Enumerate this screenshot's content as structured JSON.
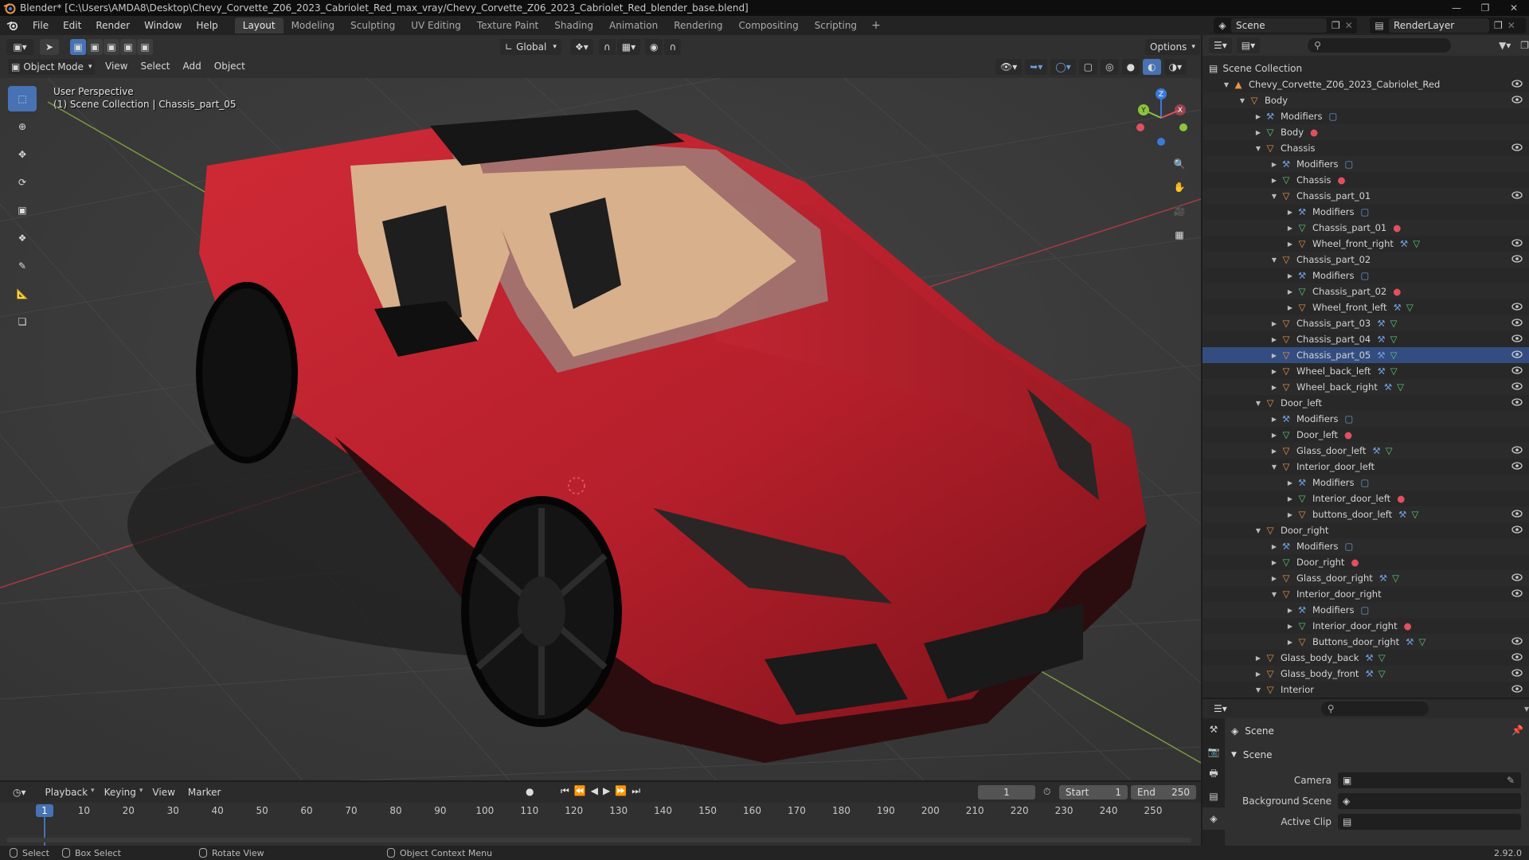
{
  "window": {
    "title": "Blender* [C:\\Users\\AMDA8\\Desktop\\Chevy_Corvette_Z06_2023_Cabriolet_Red_max_vray/Chevy_Corvette_Z06_2023_Cabriolet_Red_blender_base.blend]"
  },
  "menus": [
    "File",
    "Edit",
    "Render",
    "Window",
    "Help"
  ],
  "workspaces": {
    "tabs": [
      "Layout",
      "Modeling",
      "Sculpting",
      "UV Editing",
      "Texture Paint",
      "Shading",
      "Animation",
      "Rendering",
      "Compositing",
      "Scripting"
    ],
    "active": "Layout",
    "add": "+"
  },
  "scene": {
    "scene_name": "Scene",
    "view_layer": "RenderLayer"
  },
  "viewport_header": {
    "transform_orientation": "Global",
    "options": "Options",
    "mode": "Object Mode",
    "menus": [
      "View",
      "Select",
      "Add",
      "Object"
    ]
  },
  "viewport": {
    "perspective_label": "User Perspective",
    "context_label": "(1) Scene Collection | Chassis_part_05",
    "gizmo_axes": {
      "x": "X",
      "y": "Y",
      "z": "Z"
    }
  },
  "outliner": {
    "root": "Scene Collection",
    "items": [
      {
        "label": "Chevy_Corvette_Z06_2023_Cabriolet_Red",
        "depth": 0,
        "type": "collection",
        "open": true,
        "eye": true
      },
      {
        "label": "Body",
        "depth": 1,
        "type": "empty",
        "open": true,
        "eye": true
      },
      {
        "label": "Modifiers",
        "depth": 2,
        "type": "modifiers",
        "open": false,
        "eye": false,
        "extras": [
          "modifier"
        ]
      },
      {
        "label": "Body",
        "depth": 2,
        "type": "mesh",
        "open": false,
        "eye": false,
        "extras": [
          "material"
        ]
      },
      {
        "label": "Chassis",
        "depth": 2,
        "type": "empty",
        "open": true,
        "eye": true
      },
      {
        "label": "Modifiers",
        "depth": 3,
        "type": "modifiers",
        "open": false,
        "eye": false,
        "extras": [
          "modifier"
        ]
      },
      {
        "label": "Chassis",
        "depth": 3,
        "type": "mesh",
        "open": false,
        "eye": false,
        "extras": [
          "material"
        ]
      },
      {
        "label": "Chassis_part_01",
        "depth": 3,
        "type": "empty",
        "open": true,
        "eye": true
      },
      {
        "label": "Modifiers",
        "depth": 4,
        "type": "modifiers",
        "open": false,
        "eye": false,
        "extras": [
          "modifier"
        ]
      },
      {
        "label": "Chassis_part_01",
        "depth": 4,
        "type": "mesh",
        "open": false,
        "eye": false,
        "extras": [
          "material"
        ]
      },
      {
        "label": "Wheel_front_right",
        "depth": 4,
        "type": "object",
        "open": false,
        "eye": true,
        "extras": [
          "wrench",
          "mesh"
        ]
      },
      {
        "label": "Chassis_part_02",
        "depth": 3,
        "type": "empty",
        "open": true,
        "eye": true
      },
      {
        "label": "Modifiers",
        "depth": 4,
        "type": "modifiers",
        "open": false,
        "eye": false,
        "extras": [
          "modifier"
        ]
      },
      {
        "label": "Chassis_part_02",
        "depth": 4,
        "type": "mesh",
        "open": false,
        "eye": false,
        "extras": [
          "material"
        ]
      },
      {
        "label": "Wheel_front_left",
        "depth": 4,
        "type": "object",
        "open": false,
        "eye": true,
        "extras": [
          "wrench",
          "mesh"
        ]
      },
      {
        "label": "Chassis_part_03",
        "depth": 3,
        "type": "object",
        "open": false,
        "eye": true,
        "extras": [
          "wrench",
          "mesh"
        ]
      },
      {
        "label": "Chassis_part_04",
        "depth": 3,
        "type": "object",
        "open": false,
        "eye": true,
        "extras": [
          "wrench",
          "mesh"
        ]
      },
      {
        "label": "Chassis_part_05",
        "depth": 3,
        "type": "object",
        "open": false,
        "eye": true,
        "extras": [
          "wrench",
          "mesh"
        ],
        "active": true
      },
      {
        "label": "Wheel_back_left",
        "depth": 3,
        "type": "object",
        "open": false,
        "eye": true,
        "extras": [
          "wrench",
          "mesh"
        ]
      },
      {
        "label": "Wheel_back_right",
        "depth": 3,
        "type": "object",
        "open": false,
        "eye": true,
        "extras": [
          "wrench",
          "mesh"
        ]
      },
      {
        "label": "Door_left",
        "depth": 2,
        "type": "empty",
        "open": true,
        "eye": true
      },
      {
        "label": "Modifiers",
        "depth": 3,
        "type": "modifiers",
        "open": false,
        "eye": false,
        "extras": [
          "modifier"
        ]
      },
      {
        "label": "Door_left",
        "depth": 3,
        "type": "mesh",
        "open": false,
        "eye": false,
        "extras": [
          "material"
        ]
      },
      {
        "label": "Glass_door_left",
        "depth": 3,
        "type": "object",
        "open": false,
        "eye": true,
        "extras": [
          "wrench",
          "mesh"
        ]
      },
      {
        "label": "Interior_door_left",
        "depth": 3,
        "type": "empty",
        "open": true,
        "eye": true
      },
      {
        "label": "Modifiers",
        "depth": 4,
        "type": "modifiers",
        "open": false,
        "eye": false,
        "extras": [
          "modifier"
        ]
      },
      {
        "label": "Interior_door_left",
        "depth": 4,
        "type": "mesh",
        "open": false,
        "eye": false,
        "extras": [
          "material"
        ]
      },
      {
        "label": "buttons_door_left",
        "depth": 4,
        "type": "object",
        "open": false,
        "eye": true,
        "extras": [
          "wrench",
          "mesh"
        ]
      },
      {
        "label": "Door_right",
        "depth": 2,
        "type": "empty",
        "open": true,
        "eye": true
      },
      {
        "label": "Modifiers",
        "depth": 3,
        "type": "modifiers",
        "open": false,
        "eye": false,
        "extras": [
          "modifier"
        ]
      },
      {
        "label": "Door_right",
        "depth": 3,
        "type": "mesh",
        "open": false,
        "eye": false,
        "extras": [
          "material"
        ]
      },
      {
        "label": "Glass_door_right",
        "depth": 3,
        "type": "object",
        "open": false,
        "eye": true,
        "extras": [
          "wrench",
          "mesh"
        ]
      },
      {
        "label": "Interior_door_right",
        "depth": 3,
        "type": "empty",
        "open": true,
        "eye": true
      },
      {
        "label": "Modifiers",
        "depth": 4,
        "type": "modifiers",
        "open": false,
        "eye": false,
        "extras": [
          "modifier"
        ]
      },
      {
        "label": "Interior_door_right",
        "depth": 4,
        "type": "mesh",
        "open": false,
        "eye": false,
        "extras": [
          "material"
        ]
      },
      {
        "label": "Buttons_door_right",
        "depth": 4,
        "type": "object",
        "open": false,
        "eye": true,
        "extras": [
          "wrench",
          "mesh"
        ]
      },
      {
        "label": "Glass_body_back",
        "depth": 2,
        "type": "object",
        "open": false,
        "eye": true,
        "extras": [
          "wrench",
          "mesh"
        ]
      },
      {
        "label": "Glass_body_front",
        "depth": 2,
        "type": "object",
        "open": false,
        "eye": true,
        "extras": [
          "wrench",
          "mesh"
        ]
      },
      {
        "label": "Interior",
        "depth": 2,
        "type": "empty",
        "open": true,
        "eye": true
      }
    ]
  },
  "properties": {
    "context": "Scene",
    "panel": "Scene",
    "fields": [
      {
        "label": "Camera",
        "value": ""
      },
      {
        "label": "Background Scene",
        "value": ""
      },
      {
        "label": "Active Clip",
        "value": ""
      }
    ]
  },
  "timeline": {
    "menus": [
      "Playback",
      "Keying",
      "View",
      "Marker"
    ],
    "current_frame": "1",
    "start_label": "Start",
    "start": "1",
    "end_label": "End",
    "end": "250",
    "ticks": [
      "1",
      "10",
      "20",
      "30",
      "40",
      "50",
      "60",
      "70",
      "80",
      "90",
      "100",
      "110",
      "120",
      "130",
      "140",
      "150",
      "160",
      "170",
      "180",
      "190",
      "200",
      "210",
      "220",
      "230",
      "240",
      "250"
    ]
  },
  "statusbar": {
    "select": "Select",
    "box_select": "Box Select",
    "rotate_view": "Rotate View",
    "context_menu": "Object Context Menu",
    "version": "2.92.0"
  },
  "colors": {
    "accent": "#4772b3",
    "car_red": "#b81e2a",
    "interior_tan": "#d8b08c",
    "axis_x": "#e05060",
    "axis_y": "#8cc43c",
    "axis_z": "#3a7ad8",
    "object_orange": "#e8944a",
    "mesh_green": "#5ec87a",
    "wrench_blue": "#6f9cd8"
  }
}
